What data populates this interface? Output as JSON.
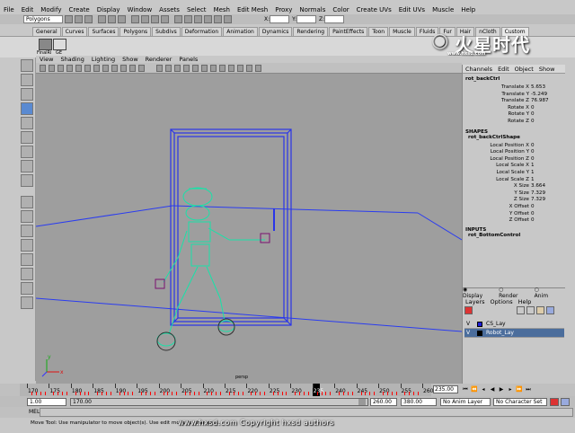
{
  "menubar": [
    "File",
    "Edit",
    "Modify",
    "Create",
    "Display",
    "Window",
    "Assets",
    "Select",
    "Mesh",
    "Edit Mesh",
    "Proxy",
    "Normals",
    "Color",
    "Create UVs",
    "Edit UVs",
    "Muscle",
    "Help"
  ],
  "statusline": {
    "mode": "Polygons",
    "field_x": "X:",
    "field_y": "Y:",
    "field_z": "Z:"
  },
  "shelf_tabs": [
    "General",
    "Curves",
    "Surfaces",
    "Polygons",
    "Subdivs",
    "Deformation",
    "Animation",
    "Dynamics",
    "Rendering",
    "PaintEffects",
    "Toon",
    "Muscle",
    "Fluids",
    "Fur",
    "Hair",
    "nCloth",
    "Custom"
  ],
  "shelf_labels": [
    "FinalRi",
    "GE"
  ],
  "logo": {
    "text": "火星时代",
    "sub": "www.hxsd.com"
  },
  "viewport_menu": [
    "View",
    "Shading",
    "Lighting",
    "Show",
    "Renderer",
    "Panels"
  ],
  "viewport": {
    "camera_label": "persp",
    "axis_x": "x",
    "axis_y": "y"
  },
  "channel_box": {
    "menu": [
      "Channels",
      "Edit",
      "Object",
      "Show"
    ],
    "node": "rot_backCtrl",
    "attrs": [
      {
        "label": "Translate X",
        "value": "5.653"
      },
      {
        "label": "Translate Y",
        "value": "-5.249"
      },
      {
        "label": "Translate Z",
        "value": "76.987"
      },
      {
        "label": "Rotate X",
        "value": "0"
      },
      {
        "label": "Rotate Y",
        "value": "0"
      },
      {
        "label": "Rotate Z",
        "value": "0"
      }
    ],
    "shapes_header": "SHAPES",
    "shape_node": "rot_backCtrlShape",
    "shape_attrs": [
      {
        "label": "Local Position X",
        "value": "0"
      },
      {
        "label": "Local Position Y",
        "value": "0"
      },
      {
        "label": "Local Position Z",
        "value": "0"
      },
      {
        "label": "Local Scale X",
        "value": "1"
      },
      {
        "label": "Local Scale Y",
        "value": "1"
      },
      {
        "label": "Local Scale Z",
        "value": "1"
      },
      {
        "label": "X Size",
        "value": "3.664"
      },
      {
        "label": "Y Size",
        "value": "7.329"
      },
      {
        "label": "Z Size",
        "value": "7.329"
      },
      {
        "label": "X Offset",
        "value": "0"
      },
      {
        "label": "Y Offset",
        "value": "0"
      },
      {
        "label": "Z Offset",
        "value": "0"
      }
    ],
    "inputs_header": "INPUTS",
    "input_node": "rot_BottomControl"
  },
  "layer_editor": {
    "modes": [
      "Display",
      "Render",
      "Anim"
    ],
    "menu": [
      "Layers",
      "Options",
      "Help"
    ],
    "layers": [
      {
        "v": "V",
        "name": "CS_Lay",
        "color": "#1f1fd8",
        "active": false
      },
      {
        "v": "V",
        "name": "Robot_Lay",
        "color": "#000000",
        "active": true
      }
    ]
  },
  "timeline": {
    "ticks": [
      "170",
      "175",
      "180",
      "185",
      "190",
      "195",
      "200",
      "205",
      "210",
      "215",
      "220",
      "225",
      "230",
      "235",
      "240",
      "245",
      "250",
      "255",
      "260"
    ],
    "current_tick": "235",
    "current_frame": "235.00"
  },
  "range": {
    "start": "1.00",
    "inner_start": "170.00",
    "inner_end": "260.00",
    "end": "380.00",
    "anim_layer": "No Anim Layer",
    "char_set": "No Character Set"
  },
  "cmdline_label": "MEL",
  "help_text": "Move Tool: Use manipulator to move object(s). Use edit mode to change p...",
  "watermark": "www.hxsd.com Copyright hxsd authors"
}
